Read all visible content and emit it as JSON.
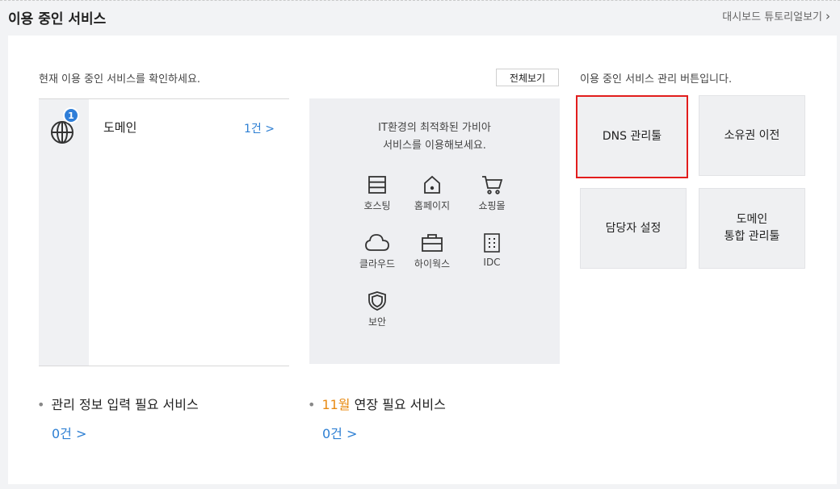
{
  "header": {
    "title": "이용 중인 서비스",
    "tutorial_link": "대시보드 튜토리얼보기",
    "tutorial_chevron": "›"
  },
  "left": {
    "description": "현재 이용 중인 서비스를 확인하세요.",
    "view_all": "전체보기",
    "services": [
      {
        "name": "도메인",
        "count": "1건 >",
        "badge": "1",
        "icon": "globe-icon"
      }
    ]
  },
  "promo": {
    "line1": "IT환경의 최적화된 가비아",
    "line2": "서비스를 이용해보세요.",
    "items": [
      {
        "label": "호스팅",
        "icon": "hosting-icon"
      },
      {
        "label": "홈페이지",
        "icon": "homepage-icon"
      },
      {
        "label": "쇼핑몰",
        "icon": "shopping-cart-icon"
      },
      {
        "label": "클라우드",
        "icon": "cloud-icon"
      },
      {
        "label": "하이웍스",
        "icon": "briefcase-icon"
      },
      {
        "label": "IDC",
        "icon": "server-icon"
      },
      {
        "label": "보안",
        "icon": "shield-icon"
      }
    ]
  },
  "management": {
    "description": "이용 중인 서비스 관리 버튼입니다.",
    "buttons": {
      "dns": "DNS 관리툴",
      "ownership": "소유권 이전",
      "contact": "담당자 설정",
      "integrated_line1": "도메인",
      "integrated_line2": "통합 관리툴"
    }
  },
  "notices": {
    "info_needed": {
      "label": "관리 정보 입력 필요 서비스",
      "count": "0건 >"
    },
    "renewal": {
      "month": "11월",
      "label": " 연장 필요 서비스",
      "count": "0건 >"
    }
  },
  "colors": {
    "accent_blue": "#2d7fd3",
    "highlight_red": "#e21d1d",
    "month_orange": "#e88a12"
  }
}
